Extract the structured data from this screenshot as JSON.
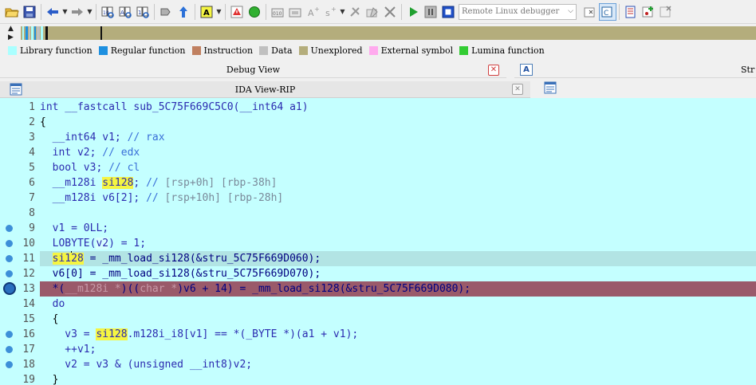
{
  "toolbar": {
    "debugger_name": "Remote Linux debugger"
  },
  "legend": [
    {
      "label": "Library function",
      "color": "#aaffff"
    },
    {
      "label": "Regular function",
      "color": "#1e90e0"
    },
    {
      "label": "Instruction",
      "color": "#c08060"
    },
    {
      "label": "Data",
      "color": "#c0c0c0"
    },
    {
      "label": "Unexplored",
      "color": "#b4ad7c"
    },
    {
      "label": "External symbol",
      "color": "#ffaaee"
    },
    {
      "label": "Lumina function",
      "color": "#33cc33"
    }
  ],
  "panels": {
    "debug_view_title": "Debug View",
    "ida_view_title": "IDA View-RIP",
    "right_panel_title": "Str"
  },
  "code": {
    "line_numbers": [
      "1",
      "2",
      "3",
      "4",
      "5",
      "6",
      "7",
      "8",
      "9",
      "10",
      "11",
      "12",
      "13",
      "14",
      "15",
      "16",
      "17",
      "18",
      "19"
    ],
    "l1": {
      "t1": "int __fastcall sub_5C75F669C5C0(__int64 a1)"
    },
    "l2": {
      "t1": "{"
    },
    "l3": {
      "t1": "  __int64 v1; ",
      "t2": "// rax"
    },
    "l4": {
      "t1": "  int v2; ",
      "t2": "// edx"
    },
    "l5": {
      "t1": "  bool v3; ",
      "t2": "// cl"
    },
    "l6": {
      "t1": "  __m128i ",
      "t2": "si128",
      "t3": "; ",
      "t4": "// ",
      "t5": "[rsp+0h] [rbp-38h]"
    },
    "l7": {
      "t1": "  __m128i v6[2]; ",
      "t2": "// ",
      "t3": "[rsp+10h] [rbp-28h]"
    },
    "l8": {
      "t1": ""
    },
    "l9": {
      "t1": "  v1 = 0LL;"
    },
    "l10": {
      "t1": "  LOBYTE(",
      "t2": "v2",
      "t3": ") = 1;"
    },
    "l11": {
      "t1": "  ",
      "t2": "si1",
      "t3": "28",
      "t4": " = _mm_load_si128(&stru_5C75F669D060);"
    },
    "l12": {
      "t1": "  v6[0] = _mm_load_si128(&stru_5C75F669D070);"
    },
    "l13": {
      "t1": "  *(",
      "t2": "__m128i *",
      "t3": ")((",
      "t4": "char *",
      "t5": ")v6 + 14) = _mm_load_si128(&stru_5C75F669D080);"
    },
    "l14": {
      "t1": "  do"
    },
    "l15": {
      "t1": "  {"
    },
    "l16": {
      "t1": "    v3 = ",
      "t2": "si128",
      "t3": ".m128i_i8[",
      "t4": "v1",
      "t5": "] == *(_BYTE *)(",
      "t6": "a1",
      "t7": " + ",
      "t8": "v1",
      "t9": ");"
    },
    "l17": {
      "t1": "    ++v1;"
    },
    "l18": {
      "t1": "    v2 = v3 & (unsigned __int8)v2;"
    },
    "l19": {
      "t1": "  }"
    }
  }
}
